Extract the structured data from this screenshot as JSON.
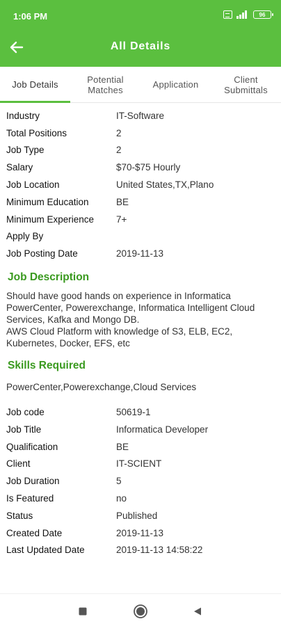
{
  "status_bar": {
    "time": "1:06 PM",
    "battery": "96"
  },
  "app_bar": {
    "title": "All Details"
  },
  "tabs": [
    {
      "label": "Job Details"
    },
    {
      "label": "Potential\nMatches"
    },
    {
      "label": "Application"
    },
    {
      "label": "Client\nSubmittals"
    }
  ],
  "details": [
    {
      "label": "Industry",
      "value": "IT-Software"
    },
    {
      "label": "Total Positions",
      "value": "2"
    },
    {
      "label": "Job Type",
      "value": "2"
    },
    {
      "label": "Salary",
      "value": "$70-$75 Hourly"
    },
    {
      "label": "Job Location",
      "value": "United States,TX,Plano"
    },
    {
      "label": "Minimum Education",
      "value": "BE"
    },
    {
      "label": "Minimum Experience",
      "value": "7+"
    },
    {
      "label": "Apply By",
      "value": ""
    },
    {
      "label": "Job Posting Date",
      "value": "2019-11-13"
    }
  ],
  "job_description": {
    "title": "Job Description",
    "text": "Should have good hands on experience in Informatica PowerCenter, Powerexchange, Informatica Intelligent Cloud Services, Kafka and Mongo DB.\nAWS Cloud Platform with knowledge of S3, ELB, EC2, Kubernetes, Docker, EFS, etc"
  },
  "skills_required": {
    "title": "Skills Required",
    "text": "PowerCenter,Powerexchange,Cloud Services"
  },
  "extra_details": [
    {
      "label": "Job code",
      "value": "50619-1"
    },
    {
      "label": "Job Title",
      "value": "Informatica Developer"
    },
    {
      "label": "Qualification",
      "value": "BE"
    },
    {
      "label": "Client",
      "value": "IT-SCIENT"
    },
    {
      "label": "Job Duration",
      "value": "5"
    },
    {
      "label": "Is Featured",
      "value": "no"
    },
    {
      "label": "Status",
      "value": "Published"
    },
    {
      "label": "Created Date",
      "value": "2019-11-13"
    },
    {
      "label": "Last Updated Date",
      "value": "2019-11-13 14:58:22"
    }
  ],
  "colors": {
    "primary": "#5bbf3f",
    "section_title": "#3a9a1f"
  },
  "icons": {
    "back": "arrow-left-icon",
    "recents": "square-icon",
    "home": "circle-icon",
    "nav_back": "triangle-left-icon"
  }
}
